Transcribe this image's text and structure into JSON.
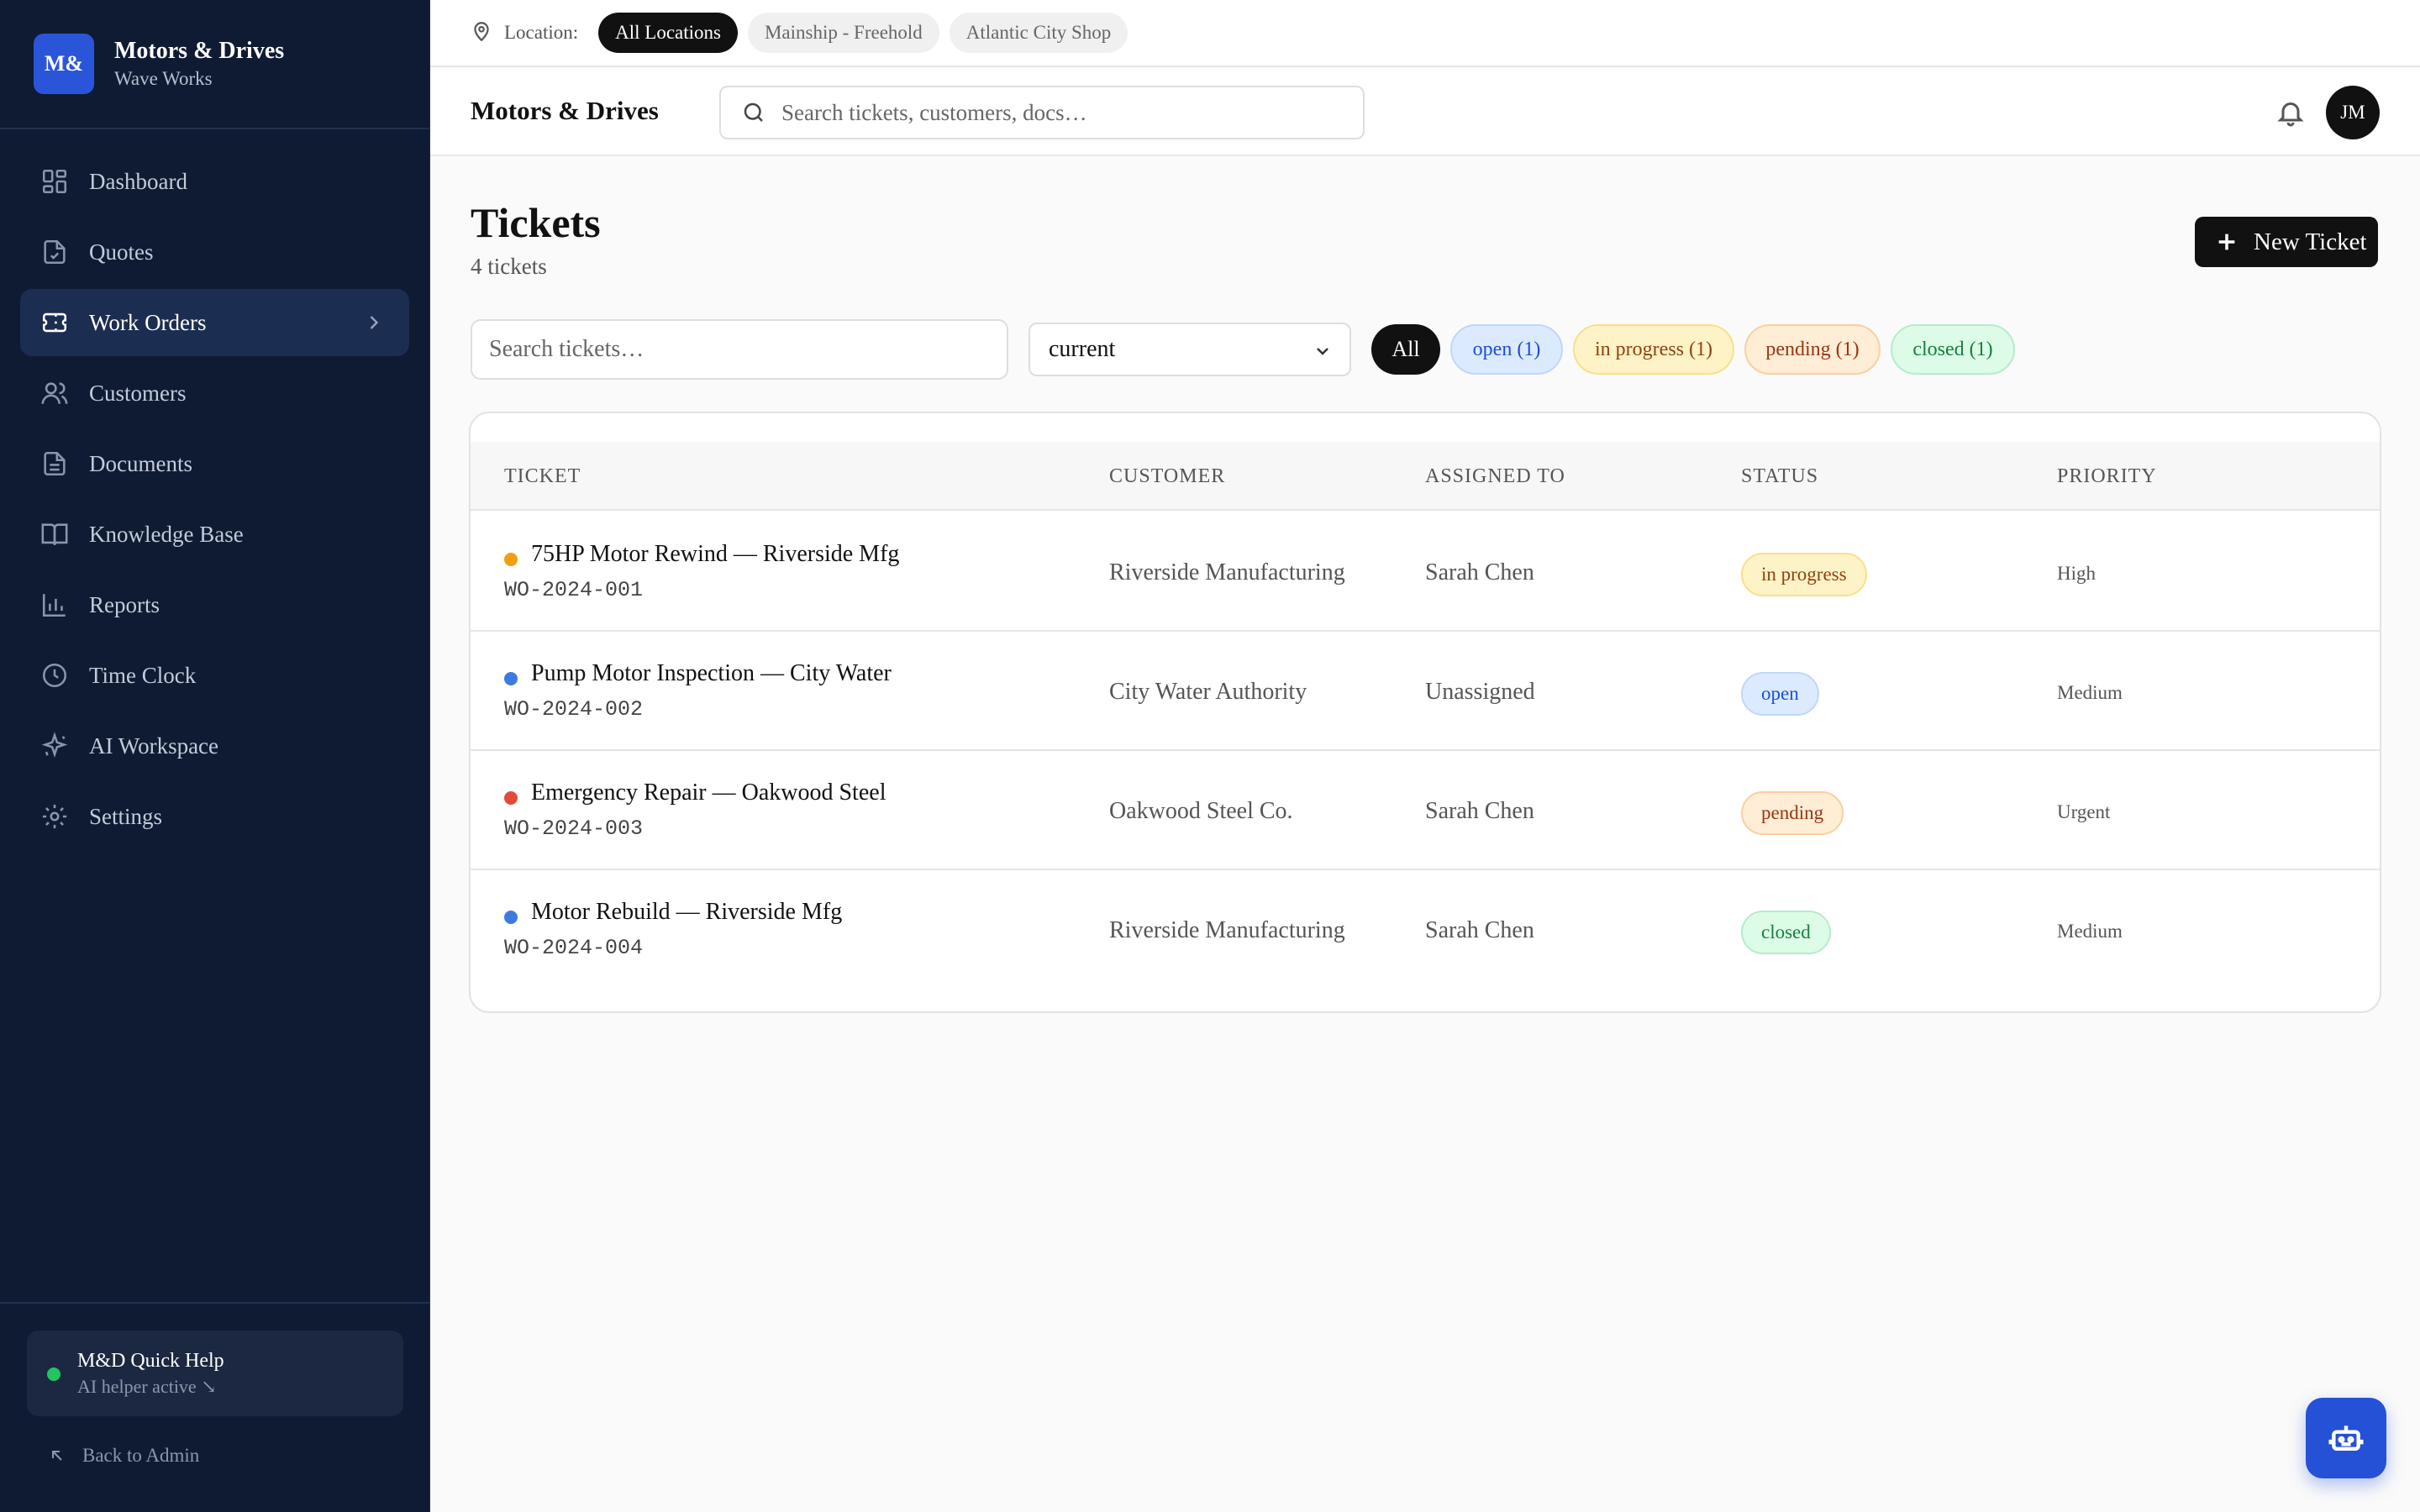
{
  "brand": {
    "logo": "M&",
    "name": "Motors & Drives",
    "sub": "Wave Works"
  },
  "nav": [
    {
      "label": "Dashboard",
      "icon": "dashboard-icon"
    },
    {
      "label": "Quotes",
      "icon": "file-check-icon"
    },
    {
      "label": "Work Orders",
      "icon": "ticket-icon",
      "active": true
    },
    {
      "label": "Customers",
      "icon": "users-icon"
    },
    {
      "label": "Documents",
      "icon": "document-icon"
    },
    {
      "label": "Knowledge Base",
      "icon": "book-icon"
    },
    {
      "label": "Reports",
      "icon": "bar-chart-icon"
    },
    {
      "label": "Time Clock",
      "icon": "clock-icon"
    },
    {
      "label": "AI Workspace",
      "icon": "sparkles-icon"
    },
    {
      "label": "Settings",
      "icon": "gear-icon"
    }
  ],
  "quick_help": {
    "title": "M&D Quick Help",
    "subtitle": "AI helper active ↘"
  },
  "back_admin": "Back to Admin",
  "location": {
    "label": "Location:",
    "options": [
      "All Locations",
      "Mainship - Freehold",
      "Atlantic City Shop"
    ],
    "selected": "All Locations"
  },
  "header": {
    "title": "Motors & Drives",
    "search_placeholder": "Search tickets, customers, docs…",
    "avatar": "JM"
  },
  "page": {
    "title": "Tickets",
    "count": "4 tickets",
    "new_button": "New Ticket",
    "search_placeholder": "Search tickets…",
    "select_value": "current"
  },
  "filters": {
    "all": "All",
    "open": "open (1)",
    "in_progress": "in progress (1)",
    "pending": "pending (1)",
    "closed": "closed (1)"
  },
  "table": {
    "headers": {
      "ticket": "TICKET",
      "customer": "CUSTOMER",
      "assigned": "ASSIGNED TO",
      "status": "STATUS",
      "priority": "PRIORITY"
    },
    "rows": [
      {
        "title": "75HP Motor Rewind — Riverside Mfg",
        "id": "WO-2024-001",
        "customer": "Riverside Manufacturing",
        "assigned": "Sarah Chen",
        "status": "in progress",
        "priority": "High",
        "dot_color": "#f59e0b",
        "badge_bg": "#fef3c7",
        "badge_fg": "#92400e",
        "badge_border": "#fadf8c"
      },
      {
        "title": "Pump Motor Inspection — City Water",
        "id": "WO-2024-002",
        "customer": "City Water Authority",
        "assigned": "Unassigned",
        "status": "open",
        "priority": "Medium",
        "dot_color": "#3b7be0",
        "badge_bg": "#dbeafe",
        "badge_fg": "#1d4ed8",
        "badge_border": "#bfd7fb"
      },
      {
        "title": "Emergency Repair — Oakwood Steel",
        "id": "WO-2024-003",
        "customer": "Oakwood Steel Co.",
        "assigned": "Sarah Chen",
        "status": "pending",
        "priority": "Urgent",
        "dot_color": "#e24a3b",
        "badge_bg": "#ffedd5",
        "badge_fg": "#9a3412",
        "badge_border": "#fbcfa0"
      },
      {
        "title": "Motor Rebuild — Riverside Mfg",
        "id": "WO-2024-004",
        "customer": "Riverside Manufacturing",
        "assigned": "Sarah Chen",
        "status": "closed",
        "priority": "Medium",
        "dot_color": "#3b7be0",
        "badge_bg": "#dcfce7",
        "badge_fg": "#15803d",
        "badge_border": "#b5eccb"
      }
    ]
  },
  "colors": {
    "sidebar": "#0f1b33",
    "accent": "#2b55d9",
    "fab": "#2451d6"
  }
}
